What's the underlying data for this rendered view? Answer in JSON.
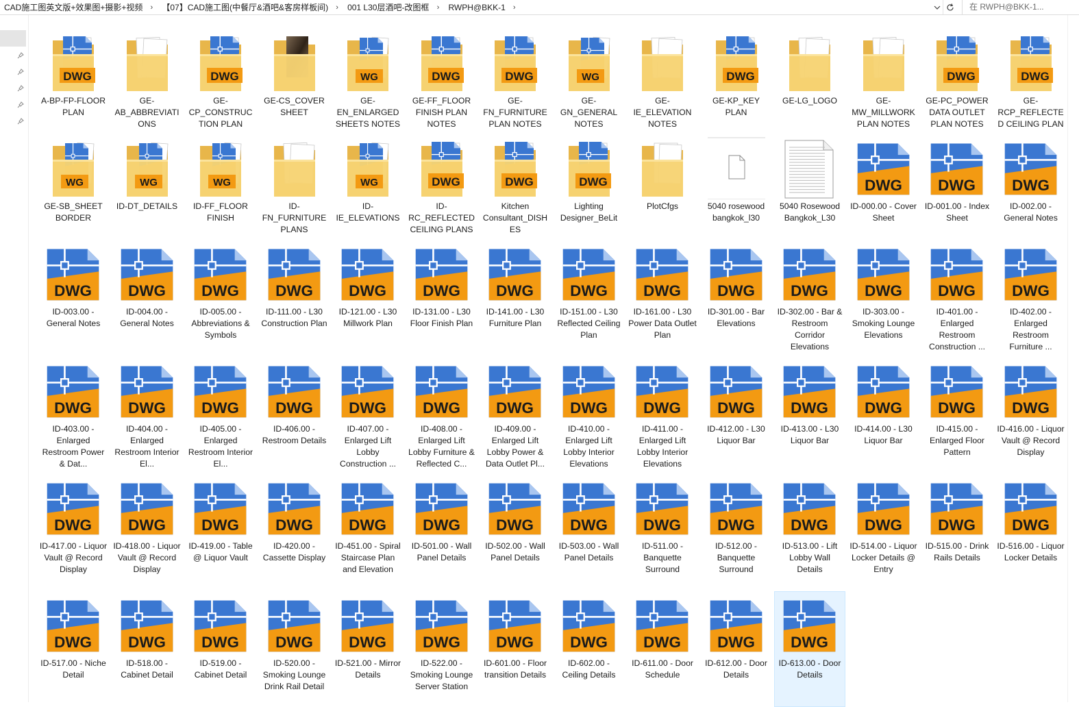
{
  "window": {
    "breadcrumb": [
      "CAD施工图英文版+效果图+摄影+视频",
      "【07】CAD施工图(中餐厅&酒吧&客房样板间)",
      "001 L30层酒吧-改图框",
      "RWPH@BKK-1"
    ],
    "search_placeholder": "在 RWPH@BKK-1..."
  },
  "colors": {
    "dwg_blue": "#3a77d1",
    "dwg_orange": "#f39a12",
    "folder_yellow": "#f7d372",
    "selection": "#e5f3ff"
  },
  "items": [
    {
      "label": "A-BP-FP-FLOOR PLAN",
      "kind": "folder-dwg"
    },
    {
      "label": "GE-AB_ABBREVIATIONS",
      "kind": "folder-doc"
    },
    {
      "label": "GE-CP_CONSTRUCTION PLAN NOTES",
      "kind": "folder-dwg"
    },
    {
      "label": "GE-CS_COVER SHEET",
      "kind": "folder-photo"
    },
    {
      "label": "GE-EN_ENLARGED SHEETS NOTES",
      "kind": "folder-mixed"
    },
    {
      "label": "GE-FF_FLOOR FINISH PLAN NOTES",
      "kind": "folder-dwg"
    },
    {
      "label": "GE-FN_FURNITURE PLAN NOTES",
      "kind": "folder-dwg"
    },
    {
      "label": "GE-GN_GENERAL NOTES",
      "kind": "folder-mixed"
    },
    {
      "label": "GE-IE_ELEVATION NOTES",
      "kind": "folder-doc"
    },
    {
      "label": "GE-KP_KEY PLAN",
      "kind": "folder-dwg"
    },
    {
      "label": "GE-LG_LOGO",
      "kind": "folder-doc"
    },
    {
      "label": "GE-MW_MILLWORK PLAN NOTES",
      "kind": "folder-doc"
    },
    {
      "label": "GE-PC_POWER DATA OUTLET PLAN NOTES",
      "kind": "folder-dwg"
    },
    {
      "label": "GE-RCP_REFLECTED CEILING PLAN NOTES",
      "kind": "folder-dwg"
    },
    {
      "label": "GE-SB_SHEET BORDER",
      "kind": "folder-mixed"
    },
    {
      "label": "ID-DT_DETAILS",
      "kind": "folder-mixed"
    },
    {
      "label": "ID-FF_FLOOR FINISH",
      "kind": "folder-mixed"
    },
    {
      "label": "ID-FN_FURNITURE PLANS",
      "kind": "folder-doc"
    },
    {
      "label": "ID-IE_ELEVATIONS",
      "kind": "folder-mixed"
    },
    {
      "label": "ID-RC_REFLECTED CEILING PLANS",
      "kind": "folder-dwg"
    },
    {
      "label": "Kitchen Consultant_DISHES",
      "kind": "folder-dwg"
    },
    {
      "label": "Lighting Designer_BeLit",
      "kind": "folder-dwg"
    },
    {
      "label": "PlotCfgs",
      "kind": "folder-empty"
    },
    {
      "label": "5040 rosewood bangkok_l30",
      "kind": "blank"
    },
    {
      "label": "5040 Rosewood Bangkok_L30",
      "kind": "text"
    },
    {
      "label": "ID-000.00 - Cover Sheet",
      "kind": "dwg"
    },
    {
      "label": "ID-001.00 - Index Sheet",
      "kind": "dwg"
    },
    {
      "label": "ID-002.00 - General Notes",
      "kind": "dwg"
    },
    {
      "label": "ID-003.00 - General Notes",
      "kind": "dwg"
    },
    {
      "label": "ID-004.00 - General Notes",
      "kind": "dwg"
    },
    {
      "label": "ID-005.00 - Abbreviations & Symbols",
      "kind": "dwg"
    },
    {
      "label": "ID-111.00 - L30 Construction Plan",
      "kind": "dwg"
    },
    {
      "label": "ID-121.00 - L30 Millwork Plan",
      "kind": "dwg"
    },
    {
      "label": "ID-131.00 - L30 Floor Finish Plan",
      "kind": "dwg"
    },
    {
      "label": "ID-141.00 - L30 Furniture Plan",
      "kind": "dwg"
    },
    {
      "label": "ID-151.00 - L30 Reflected Ceiling Plan",
      "kind": "dwg"
    },
    {
      "label": "ID-161.00 - L30 Power Data Outlet Plan",
      "kind": "dwg"
    },
    {
      "label": "ID-301.00 - Bar Elevations",
      "kind": "dwg"
    },
    {
      "label": "ID-302.00 - Bar & Restroom Corridor Elevations",
      "kind": "dwg"
    },
    {
      "label": "ID-303.00 - Smoking Lounge Elevations",
      "kind": "dwg"
    },
    {
      "label": "ID-401.00 - Enlarged Restroom Construction ...",
      "kind": "dwg"
    },
    {
      "label": "ID-402.00 - Enlarged Restroom Furniture ...",
      "kind": "dwg"
    },
    {
      "label": "ID-403.00 - Enlarged Restroom Power & Dat...",
      "kind": "dwg"
    },
    {
      "label": "ID-404.00 - Enlarged Restroom Interior El...",
      "kind": "dwg"
    },
    {
      "label": "ID-405.00 - Enlarged Restroom Interior El...",
      "kind": "dwg"
    },
    {
      "label": "ID-406.00 - Restroom Details",
      "kind": "dwg"
    },
    {
      "label": "ID-407.00 - Enlarged Lift Lobby Construction ...",
      "kind": "dwg"
    },
    {
      "label": "ID-408.00 - Enlarged Lift Lobby Furniture & Reflected C...",
      "kind": "dwg"
    },
    {
      "label": "ID-409.00 - Enlarged Lift Lobby Power & Data Outlet Pl...",
      "kind": "dwg"
    },
    {
      "label": "ID-410.00 - Enlarged Lift Lobby Interior Elevations",
      "kind": "dwg"
    },
    {
      "label": "ID-411.00 - Enlarged Lift Lobby Interior Elevations",
      "kind": "dwg"
    },
    {
      "label": "ID-412.00 - L30 Liquor Bar",
      "kind": "dwg"
    },
    {
      "label": "ID-413.00 - L30 Liquor Bar",
      "kind": "dwg"
    },
    {
      "label": "ID-414.00 - L30 Liquor Bar",
      "kind": "dwg"
    },
    {
      "label": "ID-415.00 - Enlarged Floor Pattern",
      "kind": "dwg"
    },
    {
      "label": "ID-416.00 - Liquor Vault @ Record Display",
      "kind": "dwg"
    },
    {
      "label": "ID-417.00 - Liquor Vault @ Record Display",
      "kind": "dwg"
    },
    {
      "label": "ID-418.00 - Liquor Vault @ Record Display",
      "kind": "dwg"
    },
    {
      "label": "ID-419.00 - Table @ Liquor Vault",
      "kind": "dwg"
    },
    {
      "label": "ID-420.00 - Cassette Display",
      "kind": "dwg"
    },
    {
      "label": "ID-451.00 - Spiral Staircase Plan and Elevation",
      "kind": "dwg"
    },
    {
      "label": "ID-501.00 - Wall Panel Details",
      "kind": "dwg"
    },
    {
      "label": "ID-502.00 - Wall Panel Details",
      "kind": "dwg"
    },
    {
      "label": "ID-503.00 - Wall Panel Details",
      "kind": "dwg"
    },
    {
      "label": "ID-511.00 - Banquette Surround",
      "kind": "dwg"
    },
    {
      "label": "ID-512.00 - Banquette Surround",
      "kind": "dwg"
    },
    {
      "label": "ID-513.00 - Lift Lobby Wall Details",
      "kind": "dwg"
    },
    {
      "label": "ID-514.00 - Liquor Locker Details @ Entry",
      "kind": "dwg"
    },
    {
      "label": "ID-515.00 - Drink Rails Details",
      "kind": "dwg"
    },
    {
      "label": "ID-516.00 - Liquor Locker Details",
      "kind": "dwg"
    },
    {
      "label": "ID-517.00 - Niche Detail",
      "kind": "dwg"
    },
    {
      "label": "ID-518.00 - Cabinet Detail",
      "kind": "dwg"
    },
    {
      "label": "ID-519.00 - Cabinet Detail",
      "kind": "dwg"
    },
    {
      "label": "ID-520.00 - Smoking Lounge Drink Rail Detail",
      "kind": "dwg"
    },
    {
      "label": "ID-521.00 - Mirror Details",
      "kind": "dwg"
    },
    {
      "label": "ID-522.00 - Smoking Lounge Server Station",
      "kind": "dwg"
    },
    {
      "label": "ID-601.00 - Floor transition Details",
      "kind": "dwg"
    },
    {
      "label": "ID-602.00 - Ceiling Details",
      "kind": "dwg"
    },
    {
      "label": "ID-611.00 - Door Schedule",
      "kind": "dwg"
    },
    {
      "label": "ID-612.00 - Door Details",
      "kind": "dwg"
    },
    {
      "label": "ID-613.00 - Door Details",
      "kind": "dwg",
      "selected": true
    }
  ]
}
